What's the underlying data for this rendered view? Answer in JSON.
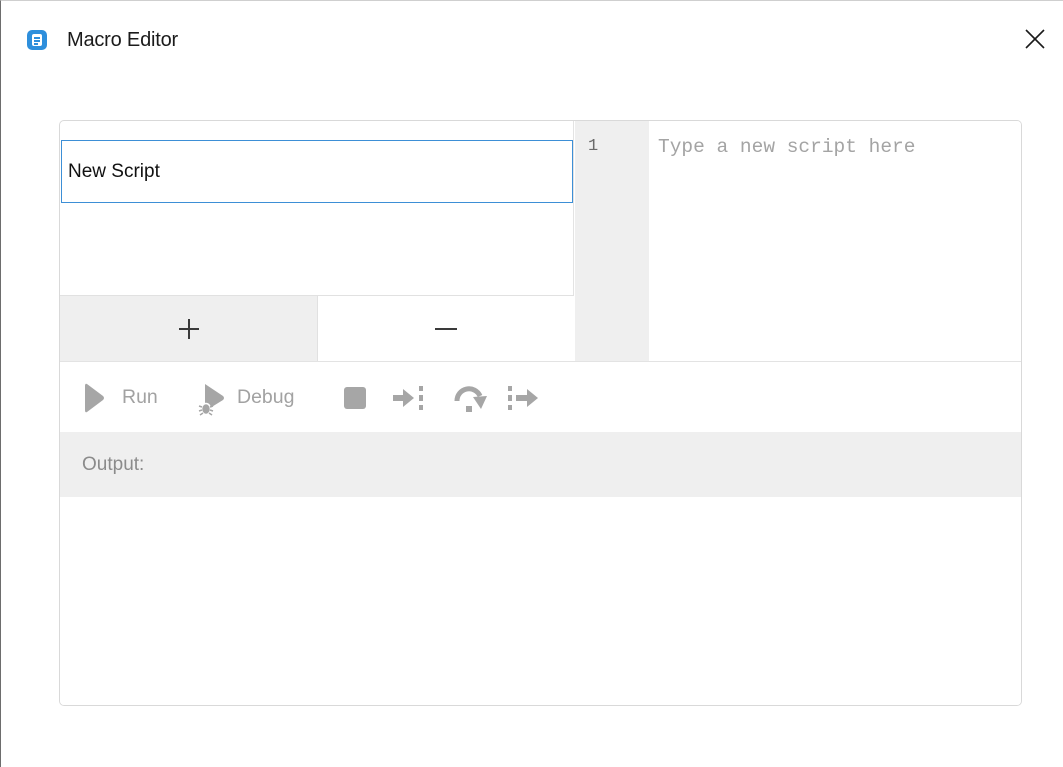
{
  "window": {
    "title": "Macro Editor",
    "app_icon": "document-icon",
    "close_icon": "close-icon"
  },
  "scripts": {
    "name_value": "New Script",
    "add_label": "+",
    "remove_label": "−"
  },
  "editor": {
    "line_numbers": [
      "1"
    ],
    "placeholder": "Type a new script here"
  },
  "toolbar": {
    "run_label": "Run",
    "debug_label": "Debug",
    "icons": [
      "play-icon",
      "debug-icon",
      "stop-icon",
      "step-into-icon",
      "step-over-icon",
      "step-out-icon"
    ]
  },
  "output": {
    "label": "Output:",
    "content": ""
  },
  "colors": {
    "accent": "#3d8fd6",
    "app_icon": "#2e8fdc",
    "disabled": "#a2a2a2",
    "panel_gray": "#efefef"
  }
}
